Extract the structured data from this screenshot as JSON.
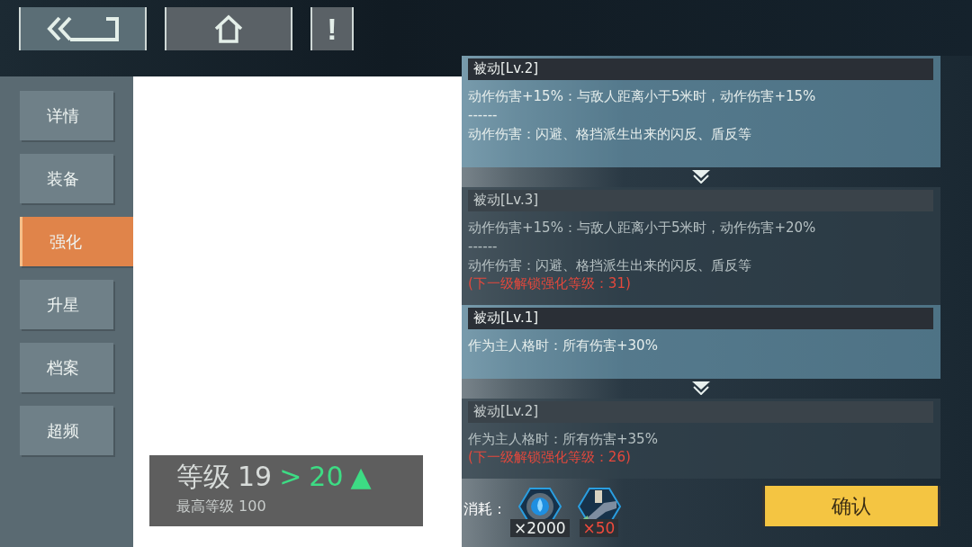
{
  "top_buttons": [
    {
      "kind": "back"
    },
    {
      "kind": "home"
    },
    {
      "kind": "alert",
      "label": "!"
    }
  ],
  "tabs": [
    {
      "label": "详情",
      "selected": false
    },
    {
      "label": "装备",
      "selected": false
    },
    {
      "label": "强化",
      "selected": true
    },
    {
      "label": "升星",
      "selected": false
    },
    {
      "label": "档案",
      "selected": false
    },
    {
      "label": "超频",
      "selected": false
    }
  ],
  "skills": [
    {
      "current": {
        "title": "被动[Lv.2]",
        "lines": [
          "动作伤害+15%：与敌人距离小于5米时，动作伤害+15%",
          "------",
          "动作伤害：闪避、格挡派生出来的闪反、盾反等"
        ]
      },
      "next": {
        "title": "被动[Lv.3]",
        "lines": [
          "动作伤害+15%：与敌人距离小于5米时，动作伤害+20%",
          "------",
          "动作伤害：闪避、格挡派生出来的闪反、盾反等"
        ],
        "unlock": "(下一级解锁强化等级：31)"
      }
    },
    {
      "current": {
        "title": "被动[Lv.1]",
        "lines": [
          "作为主人格时：所有伤害+30%"
        ]
      },
      "next": {
        "title": "被动[Lv.2]",
        "lines": [
          "作为主人格时：所有伤害+35%"
        ],
        "unlock": "(下一级解锁强化等级：26)"
      }
    }
  ],
  "level": {
    "label": "等级",
    "from": "19",
    "arrow": ">",
    "to": "20",
    "up_mark": "▲",
    "max_label": "最高等级 100"
  },
  "cost": {
    "label": "消耗：",
    "items": [
      {
        "kind": "orb",
        "count": "×2000",
        "insufficient": false
      },
      {
        "kind": "gun",
        "count": "×50",
        "insufficient": true
      }
    ]
  },
  "confirm": "确认"
}
